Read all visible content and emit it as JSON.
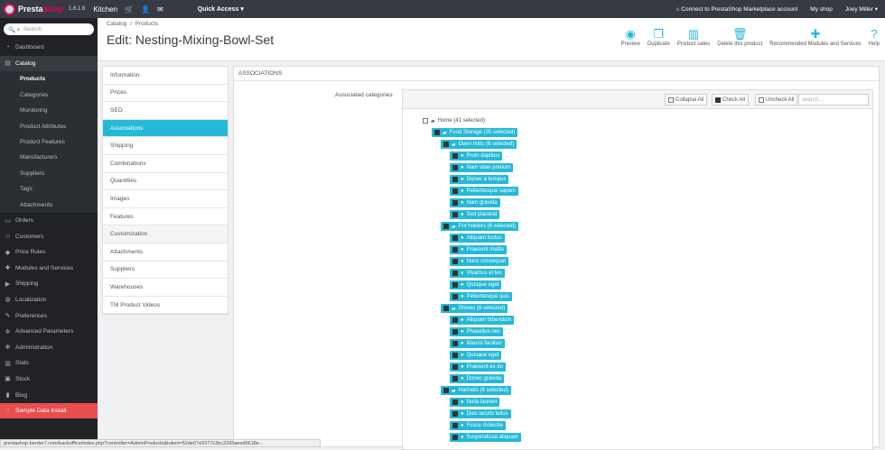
{
  "topbar": {
    "brand_a": "Presta",
    "brand_b": "Shop",
    "version": "1.6.1.6",
    "shop_name": "Kitchen",
    "quick_access": "Quick Access ▾",
    "marketplace": "Connect to PrestaShop Marketplace account",
    "my_shop": "My shop",
    "user": "Joey Miller ▾"
  },
  "sidebar": {
    "search_placeholder": "Search",
    "items": [
      {
        "label": "Dashboard",
        "icon": "speedometer-icon"
      },
      {
        "label": "Catalog",
        "icon": "catalog-icon"
      },
      {
        "label": "Orders",
        "icon": "credit-card-icon"
      },
      {
        "label": "Customers",
        "icon": "users-icon"
      },
      {
        "label": "Price Rules",
        "icon": "tag-icon"
      },
      {
        "label": "Modules and Services",
        "icon": "puzzle-icon"
      },
      {
        "label": "Shipping",
        "icon": "truck-icon"
      },
      {
        "label": "Localization",
        "icon": "globe-icon"
      },
      {
        "label": "Preferences",
        "icon": "wrench-icon"
      },
      {
        "label": "Advanced Parameters",
        "icon": "cogs-icon"
      },
      {
        "label": "Administration",
        "icon": "gear-icon"
      },
      {
        "label": "Stats",
        "icon": "bar-chart-icon"
      },
      {
        "label": "Stock",
        "icon": "box-icon"
      },
      {
        "label": "Blog",
        "icon": "book-icon"
      },
      {
        "label": "Sample Data Install",
        "icon": "download-icon"
      }
    ],
    "catalog_sub": [
      "Products",
      "Categories",
      "Monitoring",
      "Product Attributes",
      "Product Features",
      "Manufacturers",
      "Suppliers",
      "Tags",
      "Attachments"
    ]
  },
  "header": {
    "crumb_a": "Catalog",
    "crumb_sep": "/",
    "crumb_b": "Products",
    "title": "Edit: Nesting-Mixing-Bowl-Set",
    "toolbar": [
      "Preview",
      "Duplicate",
      "Product sales",
      "Delete this product",
      "Recommended Modules and Services",
      "Help"
    ]
  },
  "tabs": [
    "Information",
    "Prices",
    "SEO",
    "Associations",
    "Shipping",
    "Combinations",
    "Quantities",
    "Images",
    "Features",
    "Customization",
    "Attachments",
    "Suppliers",
    "Warehouses",
    "TM Product Videos"
  ],
  "panel": {
    "heading": "ASSOCIATIONS",
    "label": "Associated categories",
    "collapse": "Collapse All",
    "check": "Check All",
    "uncheck": "Uncheck All",
    "search_placeholder": "search..."
  },
  "tree": [
    {
      "label": "Home (41 selected)",
      "level": 0,
      "checked": false,
      "hl": false,
      "folder": true
    },
    {
      "label": "Food Storage (35 selected)",
      "level": 1,
      "checked": true,
      "hl": true,
      "folder": true
    },
    {
      "label": "Oven mitts (6 selected)",
      "level": 2,
      "checked": true,
      "hl": true,
      "folder": true
    },
    {
      "label": "Proin dapibus",
      "level": 3,
      "checked": true,
      "hl": true,
      "folder": false
    },
    {
      "label": "Nam vitae pretium",
      "level": 3,
      "checked": true,
      "hl": true,
      "folder": false
    },
    {
      "label": "Donec a tempus",
      "level": 3,
      "checked": true,
      "hl": true,
      "folder": false
    },
    {
      "label": "Pellentesque sapien",
      "level": 3,
      "checked": true,
      "hl": true,
      "folder": false
    },
    {
      "label": "Nam gravida",
      "level": 3,
      "checked": true,
      "hl": true,
      "folder": false
    },
    {
      "label": "Sed placerat",
      "level": 3,
      "checked": true,
      "hl": true,
      "folder": false
    },
    {
      "label": "Pot holders (6 selected)",
      "level": 2,
      "checked": true,
      "hl": true,
      "folder": true
    },
    {
      "label": "Aliquam luctus",
      "level": 3,
      "checked": true,
      "hl": true,
      "folder": false
    },
    {
      "label": "Praesent mattis",
      "level": 3,
      "checked": true,
      "hl": true,
      "folder": false
    },
    {
      "label": "Nunc consequat",
      "level": 3,
      "checked": true,
      "hl": true,
      "folder": false
    },
    {
      "label": "Vivamus et leo",
      "level": 3,
      "checked": true,
      "hl": true,
      "folder": false
    },
    {
      "label": "Quisque eget",
      "level": 3,
      "checked": true,
      "hl": true,
      "folder": false
    },
    {
      "label": "Pellentesque quis",
      "level": 3,
      "checked": true,
      "hl": true,
      "folder": false
    },
    {
      "label": "Gloves (6 selected)",
      "level": 2,
      "checked": true,
      "hl": true,
      "folder": true
    },
    {
      "label": "Aliquam bibendum",
      "level": 3,
      "checked": true,
      "hl": true,
      "folder": false
    },
    {
      "label": "Phasellus nec",
      "level": 3,
      "checked": true,
      "hl": true,
      "folder": false
    },
    {
      "label": "Mauris facilisis",
      "level": 3,
      "checked": true,
      "hl": true,
      "folder": false
    },
    {
      "label": "Quisque eget",
      "level": 3,
      "checked": true,
      "hl": true,
      "folder": false
    },
    {
      "label": "Praesent ex du",
      "level": 3,
      "checked": true,
      "hl": true,
      "folder": false
    },
    {
      "label": "Donec gravida",
      "level": 3,
      "checked": true,
      "hl": true,
      "folder": false
    },
    {
      "label": "Hairnets (6 selected)",
      "level": 2,
      "checked": true,
      "hl": true,
      "folder": true
    },
    {
      "label": "Nulla laoreet",
      "level": 3,
      "checked": true,
      "hl": true,
      "folder": false
    },
    {
      "label": "Duis iaculis tellus",
      "level": 3,
      "checked": true,
      "hl": true,
      "folder": false
    },
    {
      "label": "Fusce molestie",
      "level": 3,
      "checked": true,
      "hl": true,
      "folder": false
    },
    {
      "label": "Suspendisse aliquam",
      "level": 3,
      "checked": true,
      "hl": true,
      "folder": false
    }
  ],
  "statusbar": "prestashop.border7.com/backoffice/index.php?controller=AdminProducts&token=52de07e5377c2bc22d3aeed6618e..."
}
